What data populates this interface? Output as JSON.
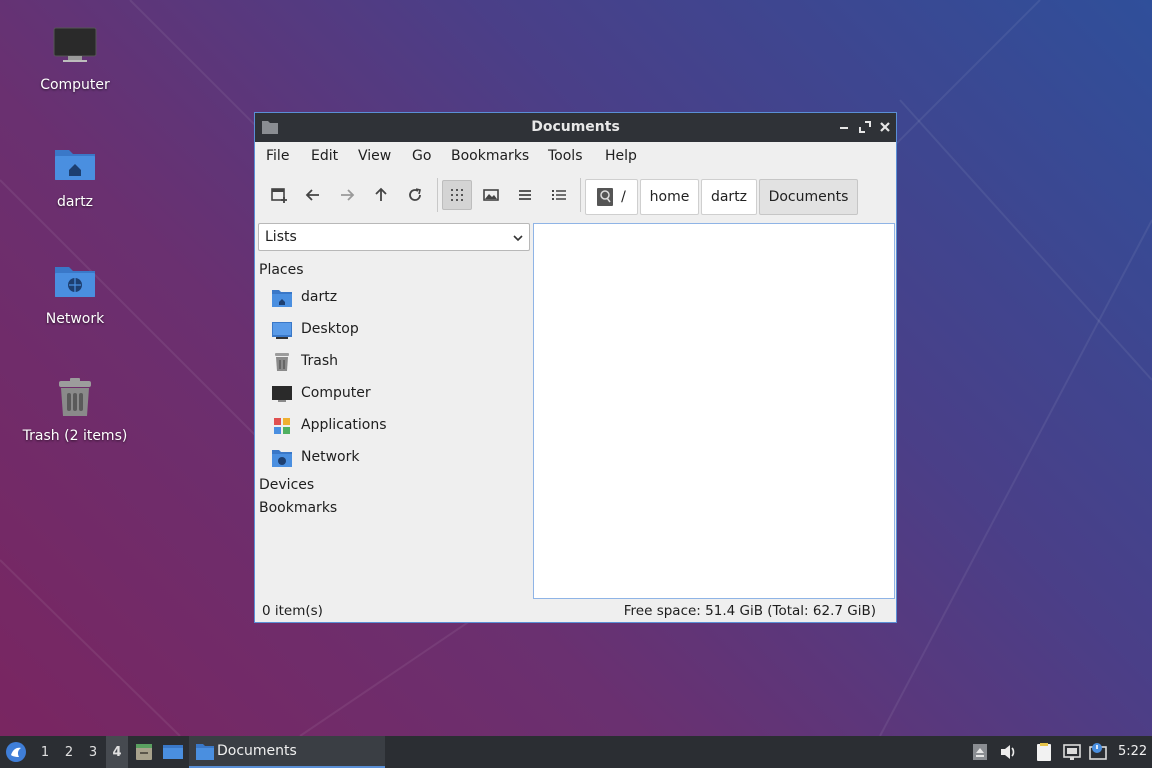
{
  "desktop": {
    "icons": [
      {
        "label": "Computer"
      },
      {
        "label": "dartz"
      },
      {
        "label": "Network"
      },
      {
        "label": "Trash (2 items)"
      }
    ]
  },
  "window": {
    "title": "Documents",
    "menu": [
      "File",
      "Edit",
      "View",
      "Go",
      "Bookmarks",
      "Tools",
      "Help"
    ],
    "toolbar": {
      "icons": [
        "new-tab-icon",
        "back-arrow-icon",
        "forward-arrow-icon",
        "up-arrow-icon",
        "reload-icon",
        "icon-view-icon",
        "thumbnail-view-icon",
        "compact-view-icon",
        "detailed-list-view-icon"
      ]
    },
    "path": {
      "root": "/",
      "segments": [
        "home",
        "dartz",
        "Documents"
      ]
    },
    "side_pane": {
      "selector": "Lists",
      "places_heading": "Places",
      "places": [
        "dartz",
        "Desktop",
        "Trash",
        "Computer",
        "Applications",
        "Network"
      ],
      "devices_heading": "Devices",
      "bookmarks_heading": "Bookmarks"
    },
    "status": {
      "items": "0 item(s)",
      "free_space": "Free space: 51.4 GiB (Total: 62.7 GiB)"
    }
  },
  "taskbar": {
    "workspaces": [
      "1",
      "2",
      "3",
      "4"
    ],
    "active_workspace": "4",
    "task_label": "Documents",
    "clock": "5:22"
  },
  "colors": {
    "accent": "#5a8fd6",
    "folder_blue": "#4a8fe0",
    "titlebar": "#2f3237",
    "taskbar": "#2b2e33"
  }
}
